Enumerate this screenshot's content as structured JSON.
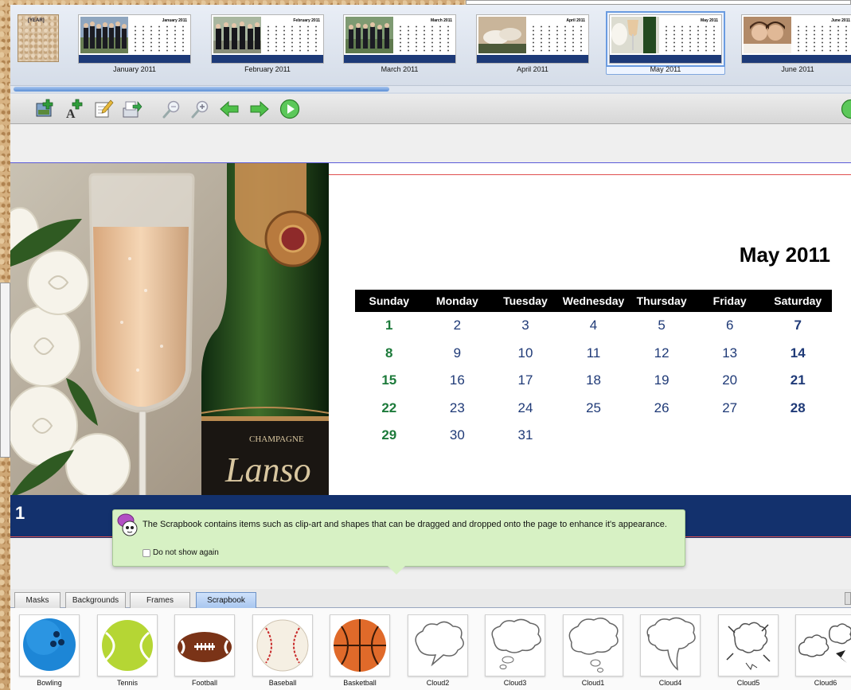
{
  "thumbnails": {
    "year_card_label": "[YEAR]",
    "months": [
      {
        "label": "January 2011",
        "mini_title": "January 2011"
      },
      {
        "label": "February 2011",
        "mini_title": "February 2011"
      },
      {
        "label": "March 2011",
        "mini_title": "March 2011"
      },
      {
        "label": "April 2011",
        "mini_title": "April 2011"
      },
      {
        "label": "May 2011",
        "mini_title": "May 2011"
      },
      {
        "label": "June 2011",
        "mini_title": "June 2011"
      }
    ],
    "selected": "May 2011"
  },
  "toolbar": {
    "icons": [
      "add-photo-icon",
      "add-text-icon",
      "edit-icon",
      "export-icon",
      "zoom-out-icon",
      "zoom-in-icon",
      "previous-arrow-icon",
      "next-arrow-icon",
      "play-icon"
    ]
  },
  "calendar": {
    "title": "May 2011",
    "weekdays": [
      "Sunday",
      "Monday",
      "Tuesday",
      "Wednesday",
      "Thursday",
      "Friday",
      "Saturday"
    ],
    "weeks": [
      [
        "1",
        "2",
        "3",
        "4",
        "5",
        "6",
        "7"
      ],
      [
        "8",
        "9",
        "10",
        "11",
        "12",
        "13",
        "14"
      ],
      [
        "15",
        "16",
        "17",
        "18",
        "19",
        "20",
        "21"
      ],
      [
        "22",
        "23",
        "24",
        "25",
        "26",
        "27",
        "28"
      ],
      [
        "29",
        "30",
        "31",
        "",
        "",
        "",
        ""
      ]
    ],
    "footer_year_fragment": "1"
  },
  "tooltip": {
    "message": "The Scrapbook contains items such as clip-art and shapes that can be dragged and dropped onto the page to enhance it's appearance.",
    "checkbox_label": "Do not show again"
  },
  "tabs": [
    {
      "label": "Masks",
      "active": false
    },
    {
      "label": "Backgrounds",
      "active": false
    },
    {
      "label": "Frames",
      "active": false
    },
    {
      "label": "Scrapbook",
      "active": true
    }
  ],
  "scrapbook": {
    "items": [
      {
        "label": "Bowling",
        "icon": "bowling-ball-icon"
      },
      {
        "label": "Tennis",
        "icon": "tennis-ball-icon"
      },
      {
        "label": "Football",
        "icon": "football-icon"
      },
      {
        "label": "Baseball",
        "icon": "baseball-icon"
      },
      {
        "label": "Basketball",
        "icon": "basketball-icon"
      },
      {
        "label": "Cloud2",
        "icon": "speech-cloud-icon"
      },
      {
        "label": "Cloud3",
        "icon": "thought-cloud-icon"
      },
      {
        "label": "Cloud1",
        "icon": "thought-cloud-icon"
      },
      {
        "label": "Cloud4",
        "icon": "speech-cloud-icon"
      },
      {
        "label": "Cloud5",
        "icon": "explosion-cloud-icon"
      },
      {
        "label": "Cloud6",
        "icon": "explosion-cloud-icon"
      }
    ]
  },
  "colors": {
    "navy_band": "#13316d",
    "sunday_green": "#1c7a3a",
    "date_blue": "#1f3a77",
    "tooltip_bg": "#d7f1c4",
    "active_tab": "#a8c6ef"
  }
}
